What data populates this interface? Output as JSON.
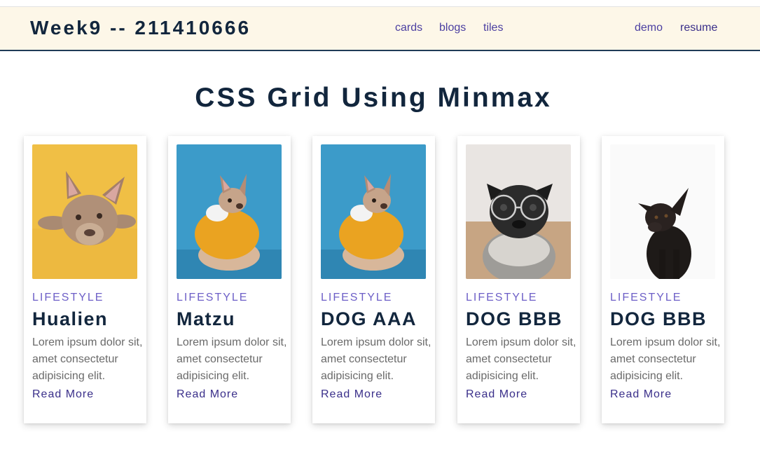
{
  "navbar": {
    "brand": "Week9 -- 211410666",
    "links": [
      "cards",
      "blogs",
      "tiles"
    ],
    "right_links": [
      "demo",
      "resume"
    ]
  },
  "page": {
    "title": "CSS Grid Using Minmax"
  },
  "cards": [
    {
      "category": "LIFESTYLE",
      "title": "Hualien",
      "text": "Lorem ipsum dolor sit, amet consectetur adipisicing elit.",
      "link": "Read More",
      "image": "french-bulldog-on-yellow"
    },
    {
      "category": "LIFESTYLE",
      "title": "Matzu",
      "text": "Lorem ipsum dolor sit, amet consectetur adipisicing elit.",
      "link": "Read More",
      "image": "french-bulldog-in-yellow-hoodie-on-blue"
    },
    {
      "category": "LIFESTYLE",
      "title": "DOG AAA",
      "text": "Lorem ipsum dolor sit, amet consectetur adipisicing elit.",
      "link": "Read More",
      "image": "french-bulldog-in-yellow-hoodie-on-blue"
    },
    {
      "category": "LIFESTYLE",
      "title": "DOG BBB",
      "text": "Lorem ipsum dolor sit, amet consectetur adipisicing elit.",
      "link": "Read More",
      "image": "pug-with-glasses-and-scarf"
    },
    {
      "category": "LIFESTYLE",
      "title": "DOG BBB",
      "text": "Lorem ipsum dolor sit, amet consectetur adipisicing elit.",
      "link": "Read More",
      "image": "black-dog-on-white"
    }
  ],
  "colors": {
    "navbar_bg": "#fdf7e8",
    "navbar_border": "#1f3b57",
    "heading": "#12263d",
    "category": "#6d5fc7",
    "link": "#3a2f8a",
    "body_text": "#6a6a6a"
  }
}
